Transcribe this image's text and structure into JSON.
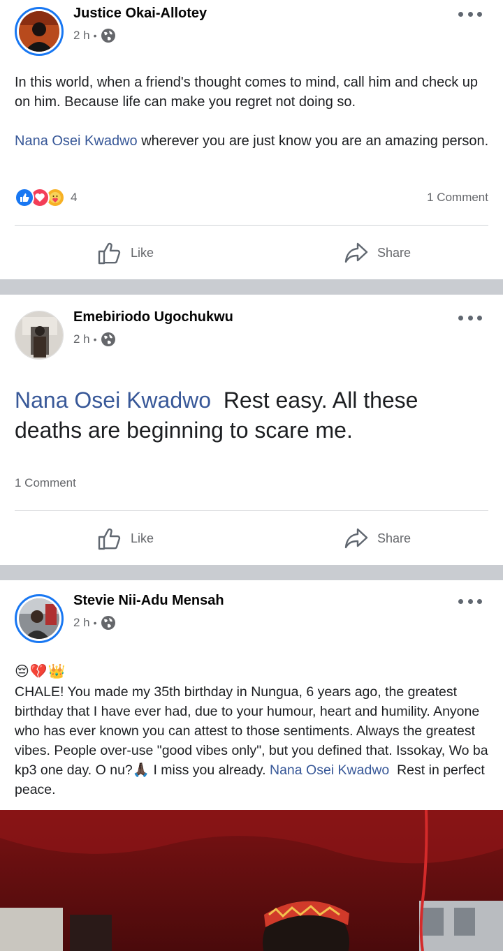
{
  "posts": [
    {
      "author": "Justice Okai-Allotey",
      "time": "2 h",
      "dot": "•",
      "paragraph1": "In this world, when a friend's thought comes to mind, call him and check up on him. Because life can make you regret not doing so.",
      "mention": "Nana Osei Kwadwo",
      "paragraph2_rest": " wherever you are just know you are an amazing person.",
      "reactions_count": "4",
      "comments": "1 Comment",
      "like_label": "Like",
      "share_label": "Share"
    },
    {
      "author": "Emebiriodo Ugochukwu",
      "time": "2 h",
      "dot": "•",
      "mention": "Nana Osei Kwadwo",
      "text_rest": "  Rest easy. All these deaths are beginning to scare me.",
      "comments": "1 Comment",
      "like_label": "Like",
      "share_label": "Share"
    },
    {
      "author": "Stevie Nii-Adu Mensah",
      "time": "2 h",
      "dot": "•",
      "emojis": "😔💔👑",
      "text_main": "CHALE! You made my 35th birthday in Nungua, 6 years ago,  the greatest birthday that I have ever had, due to your humour, heart and humility. Anyone who has ever known you can attest to those sentiments. Always the greatest vibes. People over-use \"good vibes only\", but you defined that. Issokay, Wo ba kp3 one day. O nu?🙏🏿 I miss you already. ",
      "mention": "Nana Osei Kwadwo",
      "text_end": "  Rest in perfect peace."
    }
  ],
  "colors": {
    "link": "#385898",
    "divider": "#c9ccd1",
    "accent": "#1877f2"
  }
}
